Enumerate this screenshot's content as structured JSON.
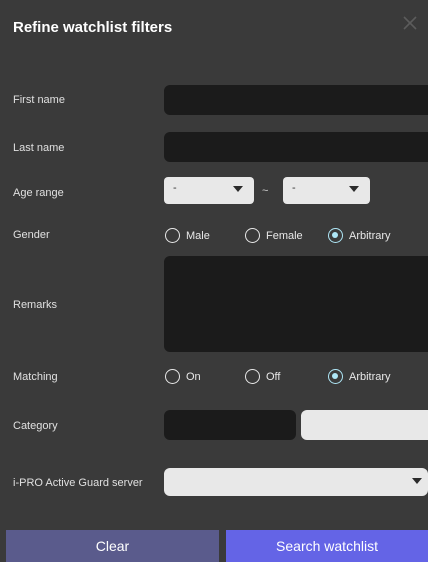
{
  "dialog": {
    "title": "Refine watchlist filters",
    "close_icon": "close-icon"
  },
  "fields": {
    "first_name": {
      "label": "First name",
      "value": ""
    },
    "last_name": {
      "label": "Last name",
      "value": ""
    },
    "age_range": {
      "label": "Age range",
      "from": "-",
      "to": "-",
      "separator": "~"
    },
    "gender": {
      "label": "Gender",
      "options": [
        "Male",
        "Female",
        "Arbitrary"
      ],
      "selected": "Arbitrary"
    },
    "remarks": {
      "label": "Remarks",
      "value": ""
    },
    "matching": {
      "label": "Matching",
      "options": [
        "On",
        "Off",
        "Arbitrary"
      ],
      "selected": "Arbitrary"
    },
    "category": {
      "label": "Category"
    },
    "server": {
      "label": "i-PRO Active Guard server",
      "value": ""
    }
  },
  "footer": {
    "clear_label": "Clear",
    "search_label": "Search watchlist"
  },
  "colors": {
    "background": "#3a3a3a",
    "field_dark": "#1b1b1b",
    "field_light": "#e8e8e8",
    "radio_selected": "#aee6f6",
    "clear_button": "#5a5b8c",
    "search_button": "#6464e6"
  }
}
